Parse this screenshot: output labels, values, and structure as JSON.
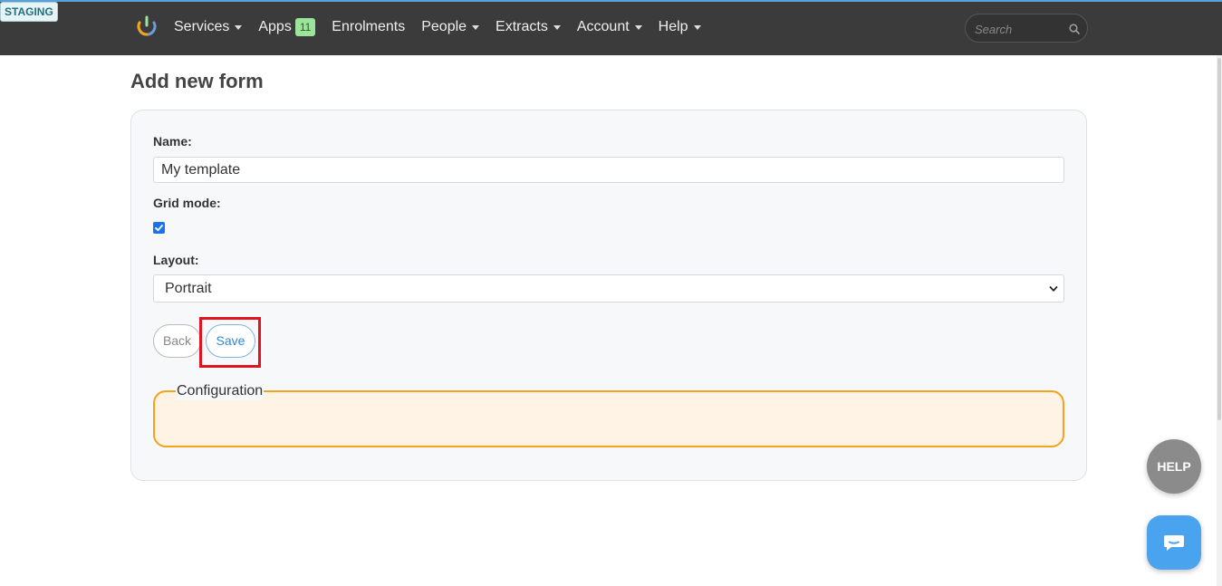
{
  "environment_badge": "STAGING",
  "nav": {
    "items": [
      {
        "label": "Services",
        "has_caret": true
      },
      {
        "label": "Apps",
        "badge": "11",
        "has_caret": false
      },
      {
        "label": "Enrolments",
        "has_caret": false
      },
      {
        "label": "People",
        "has_caret": true
      },
      {
        "label": "Extracts",
        "has_caret": true
      },
      {
        "label": "Account",
        "has_caret": true
      },
      {
        "label": "Help",
        "has_caret": true
      }
    ],
    "search_placeholder": "Search"
  },
  "page": {
    "title": "Add new form"
  },
  "form": {
    "name_label": "Name:",
    "name_value": "My template",
    "grid_mode_label": "Grid mode:",
    "grid_mode_checked": true,
    "layout_label": "Layout:",
    "layout_value": "Portrait",
    "back_label": "Back",
    "save_label": "Save",
    "configuration_legend": "Configuration"
  },
  "floating": {
    "help_label": "HELP"
  },
  "colors": {
    "topbar": "#3b3b3b",
    "accent_blue": "#2f89d1",
    "highlight_red": "#e0141e",
    "config_border": "#f5a21d",
    "config_fill": "#fff3e6"
  },
  "icons": [
    "app-logo-icon",
    "caret-down-icon",
    "search-icon",
    "checkbox-checked-icon",
    "chevron-down-icon",
    "chat-icon"
  ]
}
